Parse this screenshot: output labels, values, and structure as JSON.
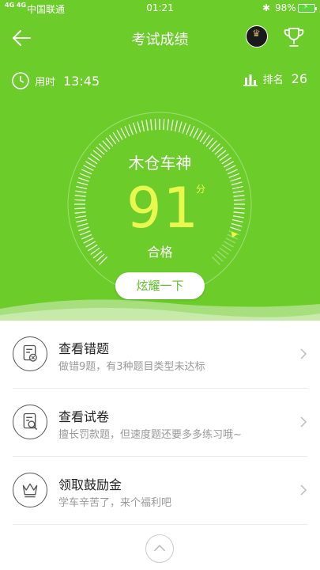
{
  "status_bar": {
    "signal": "4G 4G",
    "carrier": "中国联通",
    "time": "01:21",
    "battery": "98%"
  },
  "nav": {
    "title": "考试成绩"
  },
  "info": {
    "time_label": "用时",
    "time_value": "13:45",
    "rank_label": "排名",
    "rank_value": "26"
  },
  "result": {
    "nickname": "木仓车神",
    "score": "91",
    "score_unit": "分",
    "verdict": "合格",
    "share_label": "炫耀一下",
    "progress_fraction": 0.91
  },
  "actions": [
    {
      "title": "查看错题",
      "subtitle": "做错9题，有3种题目类型未达标",
      "icon": "wrong-answers-icon"
    },
    {
      "title": "查看试卷",
      "subtitle": "擅长罚款题，但速度题还要多多练习哦~",
      "icon": "review-paper-icon"
    },
    {
      "title": "领取鼓励金",
      "subtitle": "学车辛苦了，来个福利吧",
      "icon": "crown-reward-icon"
    }
  ],
  "colors": {
    "header_green": "#6ccd2a",
    "score_yellow": "#e9f84e",
    "button_text_green": "#5cbf2a"
  }
}
